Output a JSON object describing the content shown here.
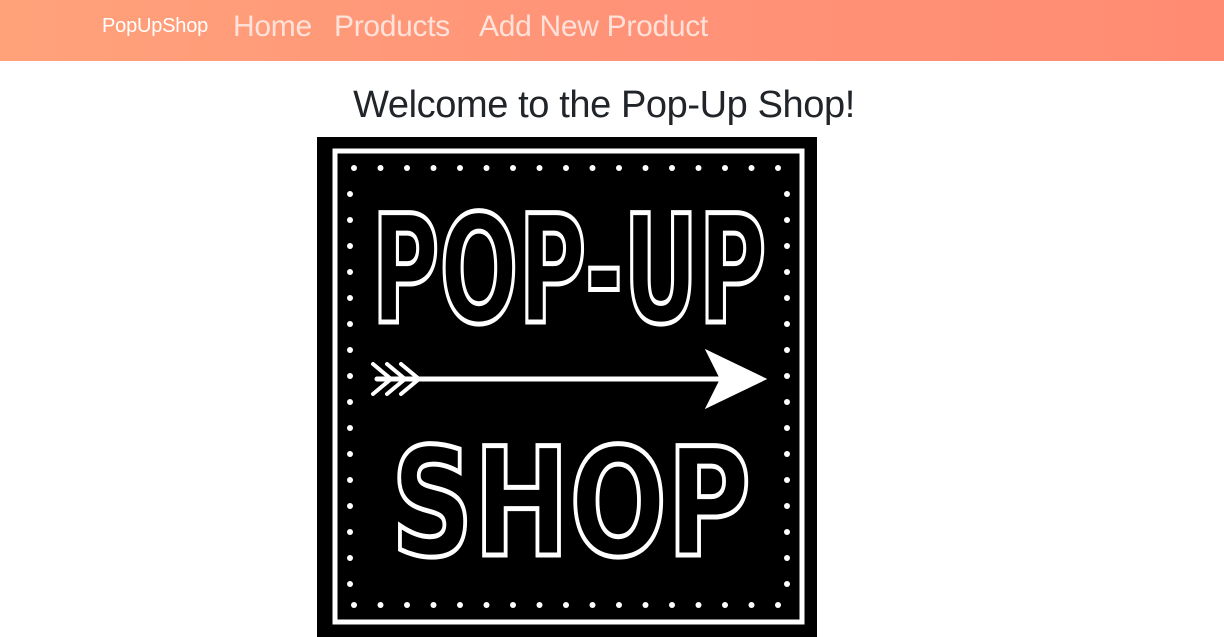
{
  "navbar": {
    "brand": "PopUpShop",
    "links": [
      {
        "label": "Home"
      },
      {
        "label": "Products"
      },
      {
        "label": "Add New Product"
      }
    ],
    "gradient_start": "#ffa27a",
    "gradient_end": "#ff8c72"
  },
  "main": {
    "heading": "Welcome to the Pop-Up Shop!",
    "logo": {
      "line1": "POP-UP",
      "line2": "SHOP",
      "background": "#000000",
      "foreground": "#ffffff",
      "icon": "arrow-right-icon"
    }
  }
}
